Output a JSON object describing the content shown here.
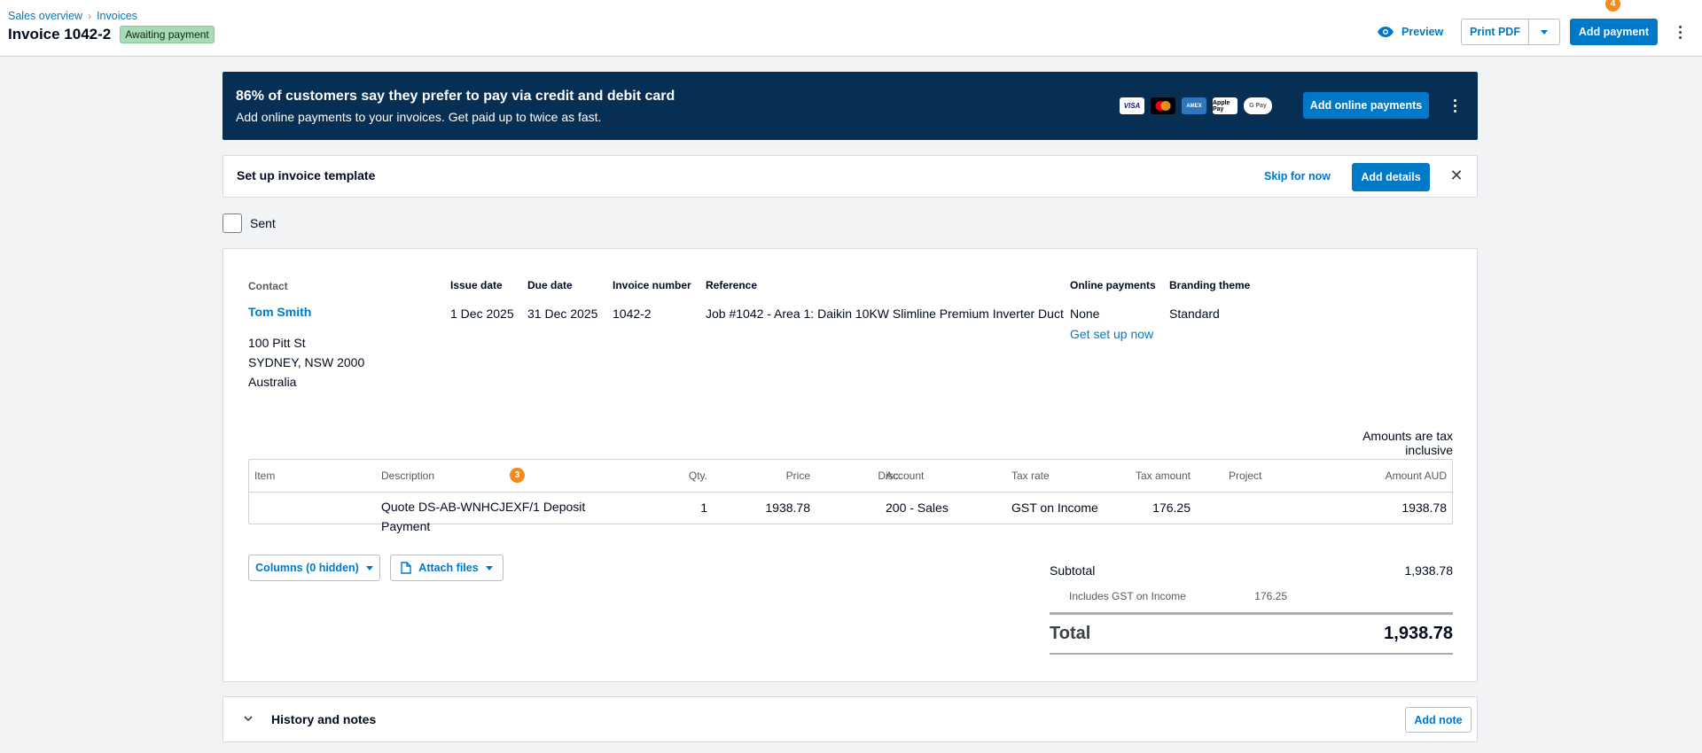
{
  "breadcrumb": {
    "items": [
      "Sales overview",
      "Invoices"
    ],
    "separator": "›"
  },
  "header": {
    "title": "Invoice 1042-2",
    "status_badge": "Awaiting payment",
    "preview_label": "Preview",
    "print_pdf_label": "Print PDF",
    "add_payment_label": "Add payment",
    "add_payment_count": "4"
  },
  "promo": {
    "headline": "86% of customers say they prefer to pay via credit and debit card",
    "subtext": "Add online payments to your invoices. Get paid up to twice as fast.",
    "cards": [
      "VISA",
      "mastercard",
      "AMEX",
      "Apple Pay",
      "G Pay"
    ],
    "button_label": "Add online payments"
  },
  "template_bar": {
    "title": "Set up invoice template",
    "skip_label": "Skip for now",
    "add_details_label": "Add details"
  },
  "sent": {
    "label": "Sent",
    "checked": false
  },
  "invoice": {
    "contact_label": "Contact",
    "contact_name": "Tom Smith",
    "address": [
      "100 Pitt St",
      "SYDNEY, NSW 2000",
      "Australia"
    ],
    "issue_date_label": "Issue date",
    "issue_date": "1 Dec 2025",
    "due_date_label": "Due date",
    "due_date": "31 Dec 2025",
    "invoice_number_label": "Invoice number",
    "invoice_number": "1042-2",
    "reference_label": "Reference",
    "reference": "Job #1042 - Area 1: Daikin 10KW Slimline Premium Inverter Duct",
    "online_payments_label": "Online payments",
    "online_payments": "None",
    "get_set_up_label": "Get set up now",
    "branding_label": "Branding theme",
    "branding": "Standard",
    "amounts_note": "Amounts are tax inclusive"
  },
  "line_items": {
    "columns": [
      "Item",
      "Description",
      "Qty.",
      "Price",
      "Disc.",
      "Account",
      "Tax rate",
      "Tax amount",
      "Project",
      "Amount AUD"
    ],
    "description_badge": "3",
    "rows": [
      {
        "item": "",
        "description_line1": "Quote DS-AB-WNHCJEXF/1 Deposit",
        "description_line2": "Payment",
        "qty": "1",
        "price": "1938.78",
        "disc": "",
        "account": "200 - Sales",
        "tax_rate": "GST on Income",
        "tax_amount": "176.25",
        "project": "",
        "amount": "1938.78"
      }
    ]
  },
  "actions": {
    "columns_label": "Columns (0 hidden)",
    "attach_label": "Attach files"
  },
  "totals": {
    "subtotal_label": "Subtotal",
    "subtotal": "1,938.78",
    "gst_label": "Includes GST on Income",
    "gst": "176.25",
    "total_label": "Total",
    "total": "1,938.78"
  },
  "history": {
    "title": "History and notes",
    "add_note_label": "Add note"
  },
  "colors": {
    "accent": "#0078c8",
    "promo_bg": "#062f53",
    "badge_bg": "#a6dbb5",
    "notify": "#f28b1e"
  },
  "icons": [
    "eye-icon",
    "chevron-down-icon",
    "more-vertical-icon",
    "close-icon",
    "file-icon",
    "chevron-right-icon"
  ]
}
